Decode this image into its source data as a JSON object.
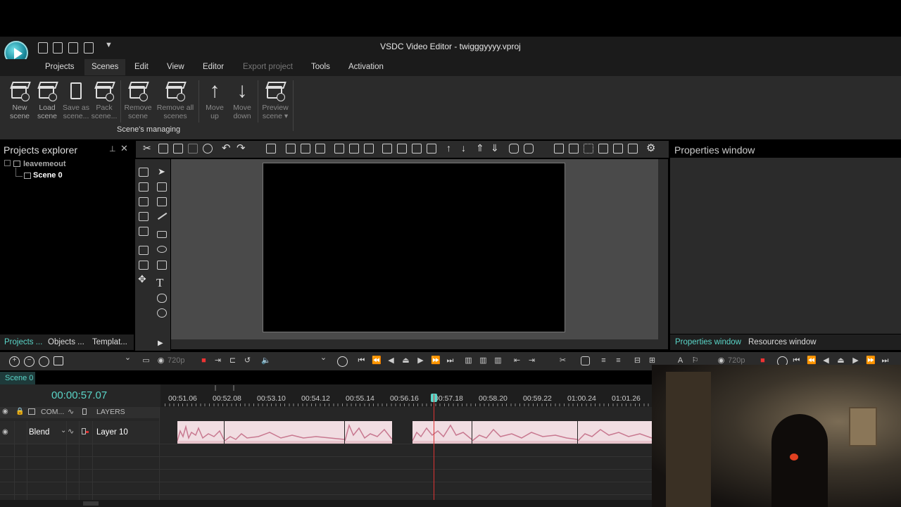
{
  "window": {
    "title": "VSDC Video Editor - twigggyyyy.vproj"
  },
  "menu": [
    {
      "label": "Projects"
    },
    {
      "label": "Scenes"
    },
    {
      "label": "Edit"
    },
    {
      "label": "View"
    },
    {
      "label": "Editor"
    },
    {
      "label": "Export project"
    },
    {
      "label": "Tools"
    },
    {
      "label": "Activation"
    }
  ],
  "ribbon": {
    "buttons": [
      {
        "line1": "New",
        "line2": "scene"
      },
      {
        "line1": "Load",
        "line2": "scene"
      },
      {
        "line1": "Save as",
        "line2": "scene..."
      },
      {
        "line1": "Pack",
        "line2": "scene..."
      },
      {
        "line1": "Remove",
        "line2": "scene"
      },
      {
        "line1": "Remove all",
        "line2": "scenes"
      },
      {
        "line1": "Move",
        "line2": "up"
      },
      {
        "line1": "Move",
        "line2": "down"
      },
      {
        "line1": "Preview",
        "line2": "scene ▾"
      }
    ],
    "group_label": "Scene's managing"
  },
  "projects_explorer": {
    "title": "Projects explorer",
    "root": "leavemeout",
    "scene": "Scene 0",
    "pin": "⊥",
    "close": "✕"
  },
  "left_tabs": [
    "Projects ...",
    "Objects ...",
    "Templat..."
  ],
  "properties": {
    "title": "Properties window"
  },
  "right_tabs": [
    "Properties window",
    "Resources window"
  ],
  "preview": {
    "resolution": "720p"
  },
  "timeline": {
    "scene_tab": "Scene 0",
    "timecode": "00:00:57.07",
    "ticks": [
      "00:51.06",
      "00:52.08",
      "00:53.10",
      "00:54.12",
      "00:55.14",
      "00:56.16",
      "00:57.18",
      "00:58.20",
      "00:59.22",
      "01:00.24",
      "01:01.26"
    ],
    "col_com": "COM...",
    "col_layers": "LAYERS",
    "layer": {
      "blend": "Blend",
      "name": "Layer 10"
    }
  }
}
